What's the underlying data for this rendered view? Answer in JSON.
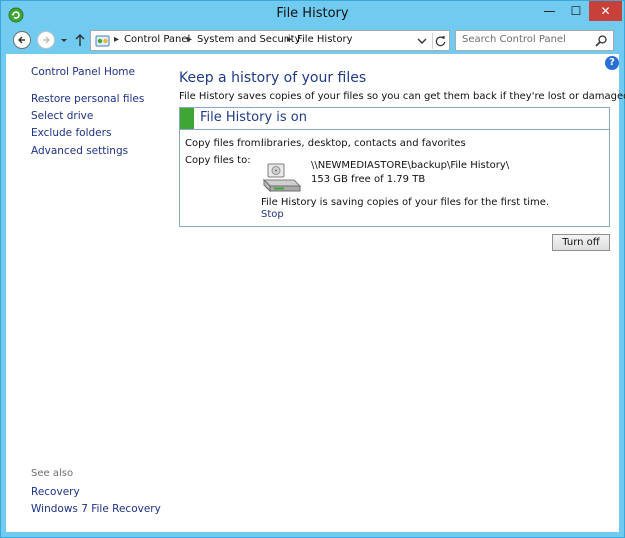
{
  "window": {
    "title": "File History",
    "minimize_glyph": "—",
    "maximize_glyph": "☐",
    "close_glyph": "✕",
    "icon": "file-history-app-icon"
  },
  "address": {
    "breadcrumbs": [
      "Control Panel",
      "System and Security",
      "File History"
    ],
    "separator": "▸"
  },
  "search": {
    "placeholder": "Search Control Panel"
  },
  "nav": {
    "home": "Control Panel Home",
    "links": [
      "Restore personal files",
      "Select drive",
      "Exclude folders",
      "Advanced settings"
    ],
    "see_also_label": "See also",
    "see_also": [
      "Recovery",
      "Windows 7 File Recovery"
    ]
  },
  "main": {
    "title": "Keep a history of your files",
    "description": "File History saves copies of your files so you can get them back if they're lost or damaged.",
    "status": {
      "title": "File History is on",
      "color": "#3fa535",
      "copy_from_label": "Copy files from:",
      "copy_from_value": "libraries, desktop, contacts and favorites",
      "copy_to_label": "Copy files to:",
      "drive_path": "\\\\NEWMEDIASTORE\\backup\\File History\\",
      "drive_free": "153 GB free of 1.79 TB",
      "saving_message": "File History is saving copies of your files for the first time.",
      "stop_label": "Stop"
    },
    "turn_off_label": "Turn off"
  },
  "help": {
    "glyph": "?"
  },
  "colors": {
    "frame": "#71cbf0",
    "link": "#1e3287",
    "heading": "#1f3b87",
    "close": "#c7403a"
  }
}
